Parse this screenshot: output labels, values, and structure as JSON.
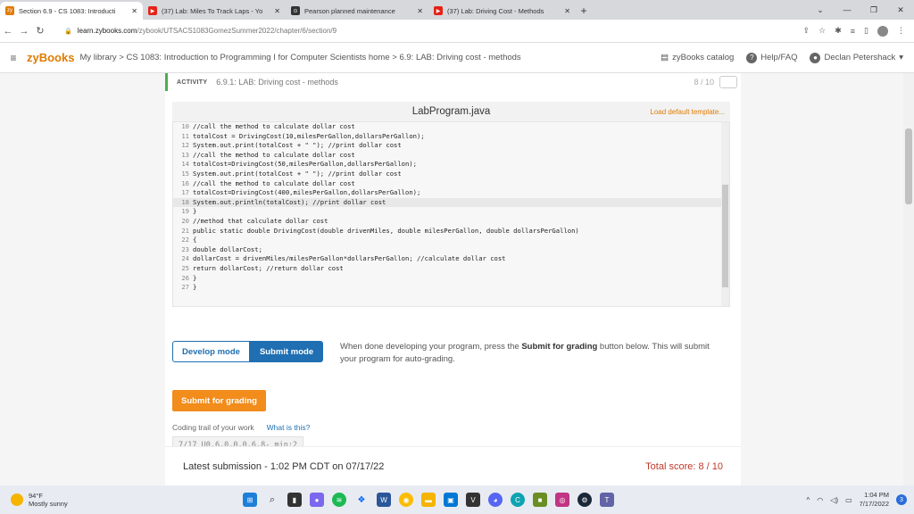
{
  "browser": {
    "tabs": [
      {
        "title": "Section 6.9 - CS 1083: Introducti",
        "favicon": "zy",
        "color": "#e07b00",
        "active": true
      },
      {
        "title": "(37) Lab: Miles To Track Laps - Yo",
        "favicon": "▶",
        "color": "#e62117",
        "active": false
      },
      {
        "title": "Pearson planned maintenance",
        "favicon": "⊙",
        "color": "#333333",
        "active": false
      },
      {
        "title": "(37) Lab: Driving Cost - Methods",
        "favicon": "▶",
        "color": "#e62117",
        "active": false
      }
    ],
    "new_tab": "+",
    "url_host": "learn.zybooks.com",
    "url_path": "/zybook/UTSACS1083GomezSummer2022/chapter/6/section/9"
  },
  "zy": {
    "logo": "zyBooks",
    "breadcrumb": "My library > CS 1083: Introduction to Programming I for Computer Scientists home > 6.9: LAB: Driving cost - methods",
    "catalog": "zyBooks catalog",
    "help": "Help/FAQ",
    "user": "Declan Petershack"
  },
  "activity": {
    "label": "ACTIVITY",
    "title": "6.9.1: LAB: Driving cost - methods",
    "score": "8 / 10"
  },
  "editor": {
    "filename": "LabProgram.java",
    "load_default": "Load default template...",
    "lines": [
      {
        "n": "10",
        "code": "//call the method to calculate dollar cost"
      },
      {
        "n": "11",
        "code": "totalCost = DrivingCost(10,milesPerGallon,dollarsPerGallon);"
      },
      {
        "n": "12",
        "code": "System.out.print(totalCost + \" \"); //print dollar cost"
      },
      {
        "n": "13",
        "code": "//call the method to calculate dollar cost"
      },
      {
        "n": "14",
        "code": "totalCost=DrivingCost(50,milesPerGallon,dollarsPerGallon);"
      },
      {
        "n": "15",
        "code": "System.out.print(totalCost + \" \"); //print dollar cost"
      },
      {
        "n": "16",
        "code": "//call the method to calculate dollar cost"
      },
      {
        "n": "17",
        "code": "totalCost=DrivingCost(400,milesPerGallon,dollarsPerGallon);"
      },
      {
        "n": "18",
        "code": "System.out.println(totalCost); //print dollar cost",
        "highlight": true
      },
      {
        "n": "19",
        "code": "}"
      },
      {
        "n": "20",
        "code": "//method that calculate dollar cost"
      },
      {
        "n": "21",
        "code": "public static double DrivingCost(double drivenMiles, double milesPerGallon, double dollarsPerGallon)"
      },
      {
        "n": "22",
        "code": "{"
      },
      {
        "n": "23",
        "code": "double dollarCost;"
      },
      {
        "n": "24",
        "code": "dollarCost = drivenMiles/milesPerGallon*dollarsPerGallon; //calculate dollar cost"
      },
      {
        "n": "25",
        "code": "return dollarCost; //return dollar cost"
      },
      {
        "n": "26",
        "code": "}"
      },
      {
        "n": "27",
        "code": "}"
      }
    ]
  },
  "modes": {
    "develop": "Develop mode",
    "submit": "Submit mode",
    "desc_pre": "When done developing your program, press the ",
    "desc_bold": "Submit for grading",
    "desc_post": " button below. This will submit your program for auto-grading."
  },
  "submit_button": "Submit for grading",
  "trail": {
    "label": "Coding trail of your work",
    "what": "What is this?",
    "value": "7/17 U0,6,0,0,0,6,8- min:2"
  },
  "latest": {
    "text": "Latest submission - 1:02 PM CDT on 07/17/22",
    "score": "Total score: 8 / 10"
  },
  "taskbar": {
    "temp": "94°F",
    "weather": "Mostly sunny",
    "time": "1:04 PM",
    "date": "7/17/2022",
    "notifications": "3"
  }
}
